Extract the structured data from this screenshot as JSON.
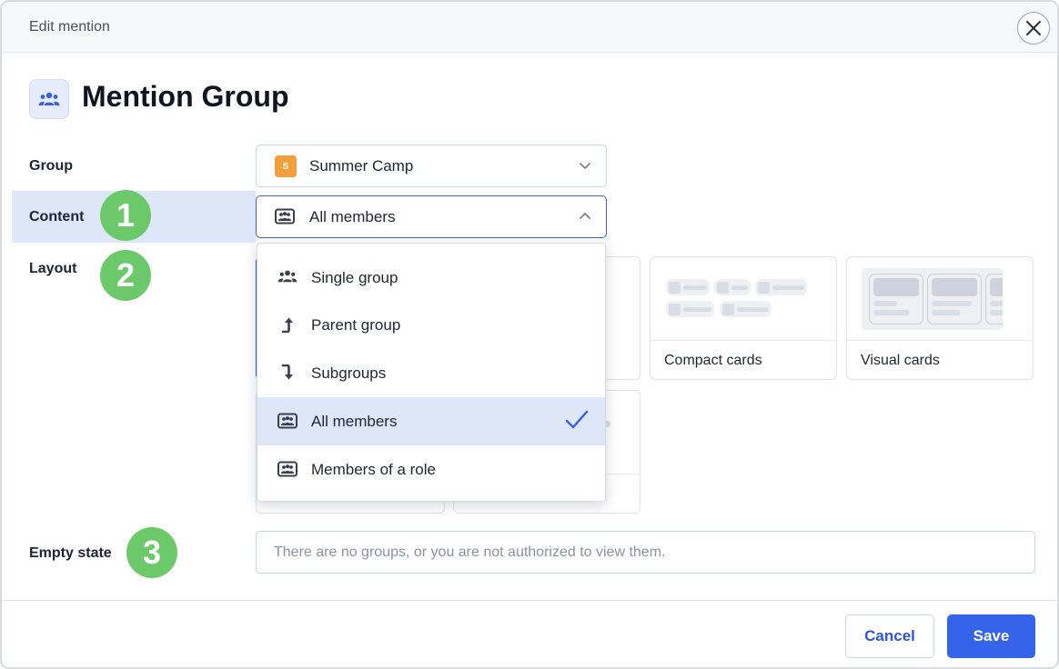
{
  "modal": {
    "title": "Edit mention"
  },
  "page": {
    "title": "Mention Group",
    "icon": "people-group-icon"
  },
  "form": {
    "group_label": "Group",
    "content_label": "Content",
    "layout_label": "Layout",
    "empty_state_label": "Empty state",
    "group_value": "Summer Camp",
    "group_avatar_letter": "S",
    "content_value": "All members",
    "empty_state_placeholder": "There are no groups, or you are not authorized to view them."
  },
  "badges": [
    "1",
    "2",
    "3"
  ],
  "content_menu": {
    "items": [
      {
        "label": "Single group",
        "icon": "people-group-icon"
      },
      {
        "label": "Parent group",
        "icon": "arrow-up-icon"
      },
      {
        "label": "Subgroups",
        "icon": "arrow-down-icon"
      },
      {
        "label": "All members",
        "icon": "members-icon",
        "selected": true
      },
      {
        "label": "Members of a role",
        "icon": "members-icon"
      }
    ]
  },
  "layout_options": {
    "compact_cards": "Compact cards",
    "visual_cards": "Visual cards"
  },
  "footer": {
    "cancel_label": "Cancel",
    "save_label": "Save"
  },
  "colors": {
    "accent": "#3563e9",
    "badge": "#6cc96a",
    "selected_bg": "#dde7f8",
    "group_avatar": "#f2a03b"
  }
}
